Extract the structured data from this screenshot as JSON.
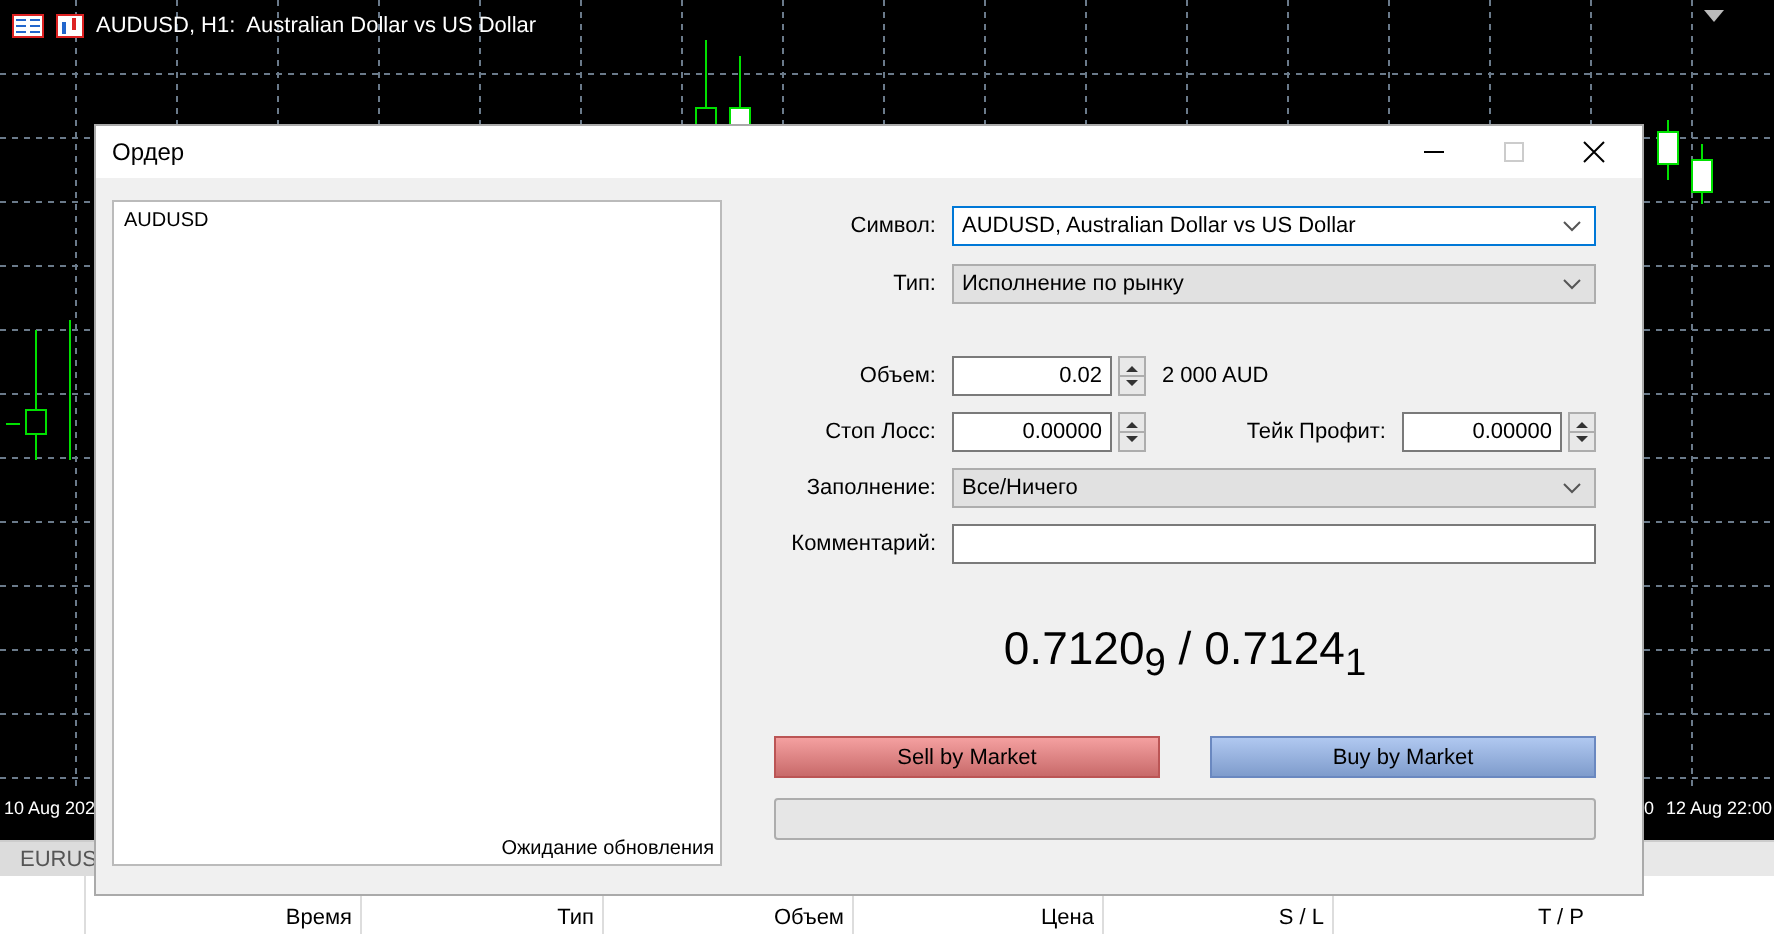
{
  "chart_window": {
    "title": "AUDUSD, H1:  Australian Dollar vs US Dollar",
    "time_labels": [
      "10 Aug 202",
      "0",
      "12 Aug 22:00"
    ]
  },
  "dialog": {
    "title": "Ордер",
    "quote_panel": {
      "symbol": "AUDUSD",
      "status": "Ожидание обновления"
    },
    "symbol": {
      "label": "Символ:",
      "value": "AUDUSD, Australian Dollar vs US Dollar",
      "focused": true
    },
    "type": {
      "label": "Тип:",
      "value": "Исполнение по рынку",
      "focused": false
    },
    "volume": {
      "label": "Объем:",
      "value": "0.02",
      "note": "2 000 AUD"
    },
    "stop_loss": {
      "label": "Стоп Лосс:",
      "value": "0.00000"
    },
    "take_profit": {
      "label": "Тейк Профит:",
      "value": "0.00000"
    },
    "filling": {
      "label": "Заполнение:",
      "value": "Все/Ничего",
      "focused": false
    },
    "comment": {
      "label": "Комментарий:"
    },
    "price": "0.7120$_{9}$ / 0.7124$_{1}$",
    "buttons": [
      {
        "kind": "sell",
        "label": "Sell by Market"
      },
      {
        "kind": "buy",
        "label": "Buy by Market"
      }
    ],
    "progress": {
      "level": 0
    }
  },
  "bottom_panel": {
    "tab": "EURUS",
    "columns": [
      "Время",
      "Тип",
      "Объем",
      "Цена",
      "S / L",
      "T / P"
    ]
  }
}
